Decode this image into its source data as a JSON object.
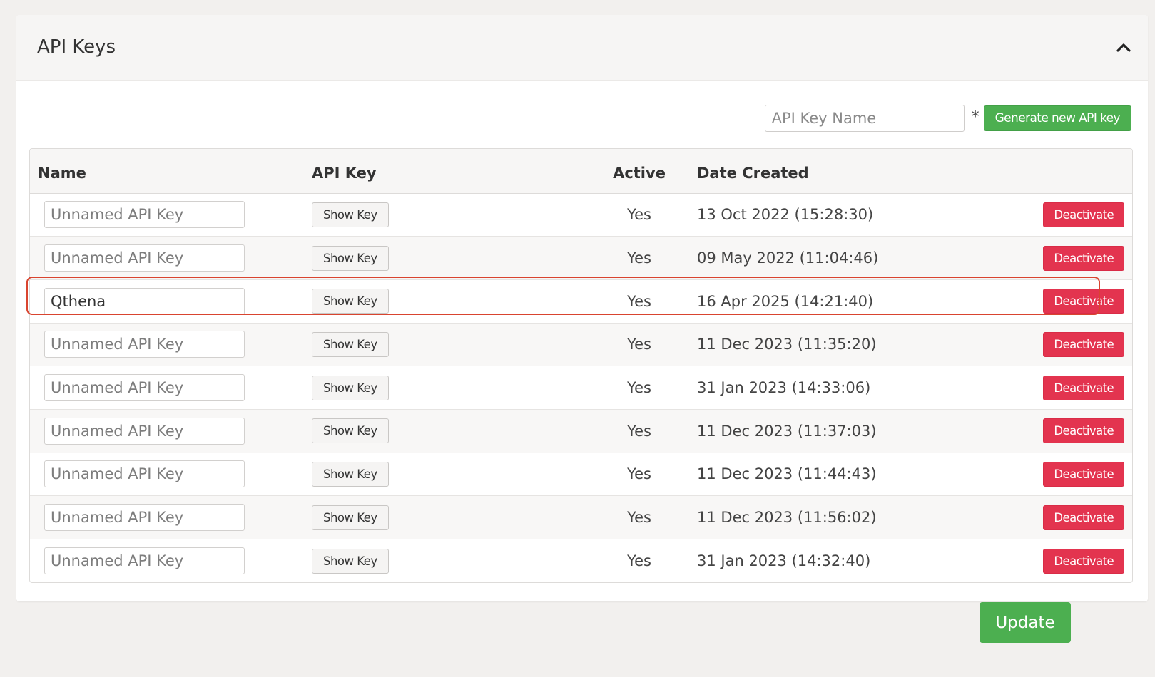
{
  "panel": {
    "title": "API Keys",
    "collapse_icon": "chevron-up-icon"
  },
  "toolbar": {
    "name_placeholder": "API Key Name",
    "required_mark": "*",
    "generate_label": "Generate new API key"
  },
  "table": {
    "headers": {
      "name": "Name",
      "api_key": "API Key",
      "active": "Active",
      "date_created": "Date Created"
    },
    "rows": [
      {
        "name_value": "",
        "name_placeholder": "Unnamed API Key",
        "show_label": "Show Key",
        "active": "Yes",
        "date": "13 Oct 2022 (15:28:30)",
        "action_label": "Deactivate"
      },
      {
        "name_value": "",
        "name_placeholder": "Unnamed API Key",
        "show_label": "Show Key",
        "active": "Yes",
        "date": "09 May 2022 (11:04:46)",
        "action_label": "Deactivate"
      },
      {
        "name_value": "Qthena",
        "name_placeholder": "Unnamed API Key",
        "show_label": "Show Key",
        "active": "Yes",
        "date": "16 Apr 2025 (14:21:40)",
        "action_label": "Deactivate",
        "highlighted": true
      },
      {
        "name_value": "",
        "name_placeholder": "Unnamed API Key",
        "show_label": "Show Key",
        "active": "Yes",
        "date": "11 Dec 2023 (11:35:20)",
        "action_label": "Deactivate"
      },
      {
        "name_value": "",
        "name_placeholder": "Unnamed API Key",
        "show_label": "Show Key",
        "active": "Yes",
        "date": "31 Jan 2023 (14:33:06)",
        "action_label": "Deactivate"
      },
      {
        "name_value": "",
        "name_placeholder": "Unnamed API Key",
        "show_label": "Show Key",
        "active": "Yes",
        "date": "11 Dec 2023 (11:37:03)",
        "action_label": "Deactivate"
      },
      {
        "name_value": "",
        "name_placeholder": "Unnamed API Key",
        "show_label": "Show Key",
        "active": "Yes",
        "date": "11 Dec 2023 (11:44:43)",
        "action_label": "Deactivate"
      },
      {
        "name_value": "",
        "name_placeholder": "Unnamed API Key",
        "show_label": "Show Key",
        "active": "Yes",
        "date": "11 Dec 2023 (11:56:02)",
        "action_label": "Deactivate"
      },
      {
        "name_value": "",
        "name_placeholder": "Unnamed API Key",
        "show_label": "Show Key",
        "active": "Yes",
        "date": "31 Jan 2023 (14:32:40)",
        "action_label": "Deactivate"
      }
    ]
  },
  "footer": {
    "update_label": "Update"
  },
  "colors": {
    "primary_green": "#4caf50",
    "danger_red": "#e3344f",
    "highlight_outline": "#d9442f"
  }
}
